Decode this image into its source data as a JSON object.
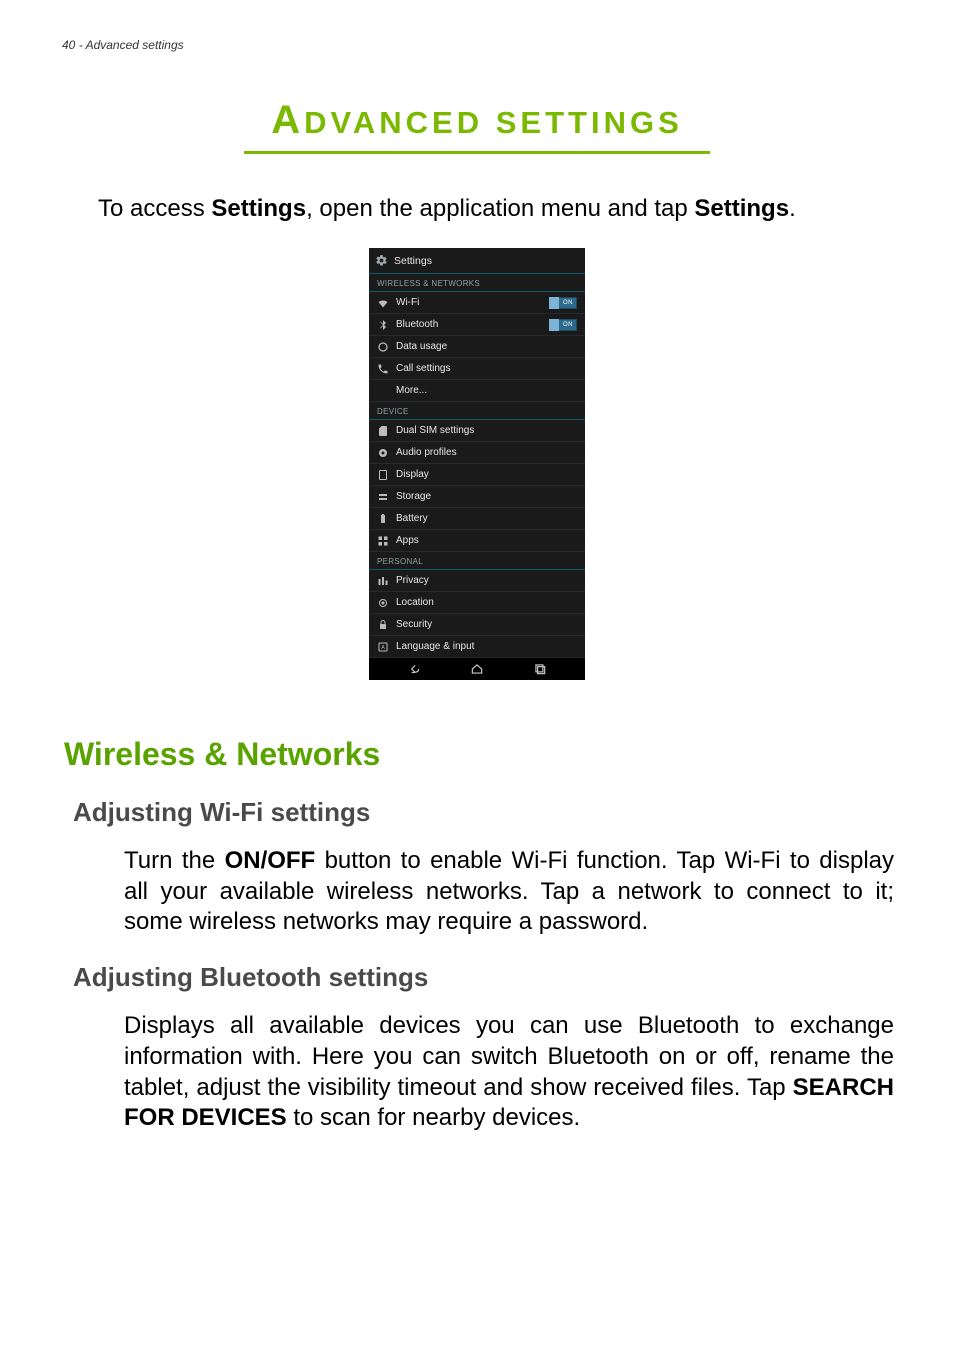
{
  "header": {
    "page_num": "40",
    "section": "Advanced settings"
  },
  "title": {
    "text_big": "A",
    "text_rest": "DVANCED SETTINGS"
  },
  "intro": {
    "pre": "To access ",
    "bold1": "Settings",
    "mid": ", open the application menu and tap ",
    "bold2": "Settings",
    "post": "."
  },
  "phone": {
    "header_label": "Settings",
    "sections": {
      "wireless": {
        "label": "WIRELESS & NETWORKS",
        "rows": {
          "wifi": "Wi-Fi",
          "bluetooth": "Bluetooth",
          "data_usage": "Data usage",
          "call_settings": "Call settings",
          "more": "More..."
        },
        "toggle_on": "ON"
      },
      "device": {
        "label": "DEVICE",
        "rows": {
          "dual_sim": "Dual SIM settings",
          "audio": "Audio profiles",
          "display": "Display",
          "storage": "Storage",
          "battery": "Battery",
          "apps": "Apps"
        }
      },
      "personal": {
        "label": "PERSONAL",
        "rows": {
          "privacy": "Privacy",
          "location": "Location",
          "security": "Security",
          "language": "Language & input"
        }
      }
    }
  },
  "h2": {
    "wireless": "Wireless & Networks"
  },
  "h3": {
    "wifi": "Adjusting Wi-Fi settings",
    "bluetooth": "Adjusting Bluetooth settings"
  },
  "para": {
    "wifi": {
      "pre": "Turn the ",
      "bold": "ON/OFF",
      "post": " button to enable Wi-Fi function. Tap Wi-Fi to display all your available wireless networks. Tap a network to connect to it; some wireless networks may require a password."
    },
    "bluetooth": {
      "pre": "Displays all available devices you can use Bluetooth to exchange information with. Here you can switch Bluetooth on or off, rename the tablet, adjust the visibility timeout and show received files. Tap ",
      "bold": "SEARCH FOR DEVICES",
      "post": " to scan for nearby devices."
    }
  }
}
